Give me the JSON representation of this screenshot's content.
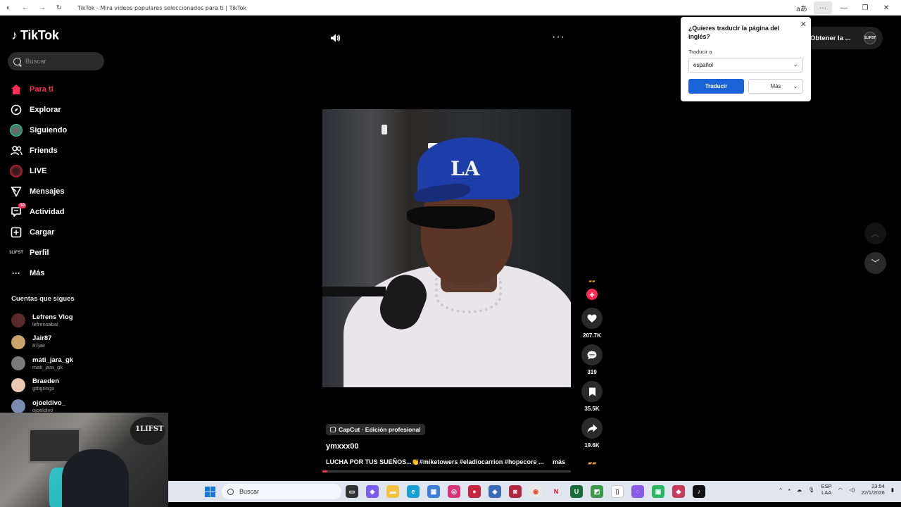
{
  "browser": {
    "tab_title": "TikTok - Mira videos populares seleccionados para ti | TikTok"
  },
  "sidebar": {
    "logo": "TikTok",
    "search_placeholder": "Buscar",
    "nav": [
      {
        "label": "Para ti",
        "icon": "home-icon",
        "active": true
      },
      {
        "label": "Explorar",
        "icon": "compass-icon"
      },
      {
        "label": "Siguiendo",
        "icon": "following-avatar-icon"
      },
      {
        "label": "Friends",
        "icon": "friends-icon"
      },
      {
        "label": "LIVE",
        "icon": "live-icon"
      },
      {
        "label": "Mensajes",
        "icon": "send-icon"
      },
      {
        "label": "Actividad",
        "icon": "activity-icon",
        "badge": "10"
      },
      {
        "label": "Cargar",
        "icon": "upload-icon"
      },
      {
        "label": "Perfil",
        "icon": "profile-icon"
      },
      {
        "label": "Más",
        "icon": "more-icon"
      }
    ],
    "following_header": "Cuentas que sigues",
    "following": [
      {
        "name": "Lefrens Vlog",
        "user": "lefrensabal"
      },
      {
        "name": "Jair87",
        "user": "87jair"
      },
      {
        "name": "mati_jara_gk",
        "user": "mati_jara_gk"
      },
      {
        "name": "Braeden",
        "user": "gtbgringo"
      },
      {
        "name": "ojoeldivo_",
        "user": "ojoeldivo_"
      }
    ]
  },
  "video": {
    "actions": {
      "likes": "207.7K",
      "comments": "319",
      "saves": "35.5K",
      "shares": "19.6K"
    },
    "capcut_label": "CapCut · Edición profesional",
    "username": "ymxxx00",
    "caption": "LUCHA POR TUS SUEÑOS...👏#miketowers #eladiocarrion #hopecore ...",
    "caption_more": "más",
    "progress": 0.02
  },
  "header": {
    "get_app": "Obtener la ...",
    "get_app_avatar_text": "1LIFST"
  },
  "translate_popup": {
    "title": "¿Quieres traducir la página del inglés?",
    "label": "Traducir a",
    "selected_language": "español",
    "translate_button": "Traducir",
    "more_button": "Más"
  },
  "webcam": {
    "sign_text": "1LIFST"
  },
  "taskbar": {
    "search_placeholder": "Buscar",
    "lang_top": "ESP",
    "lang_bottom": "LAA",
    "time": "23:54",
    "date": "22/1/2026"
  },
  "colors": {
    "accent": "#fe2c55",
    "translate_button": "#1a63d6"
  }
}
